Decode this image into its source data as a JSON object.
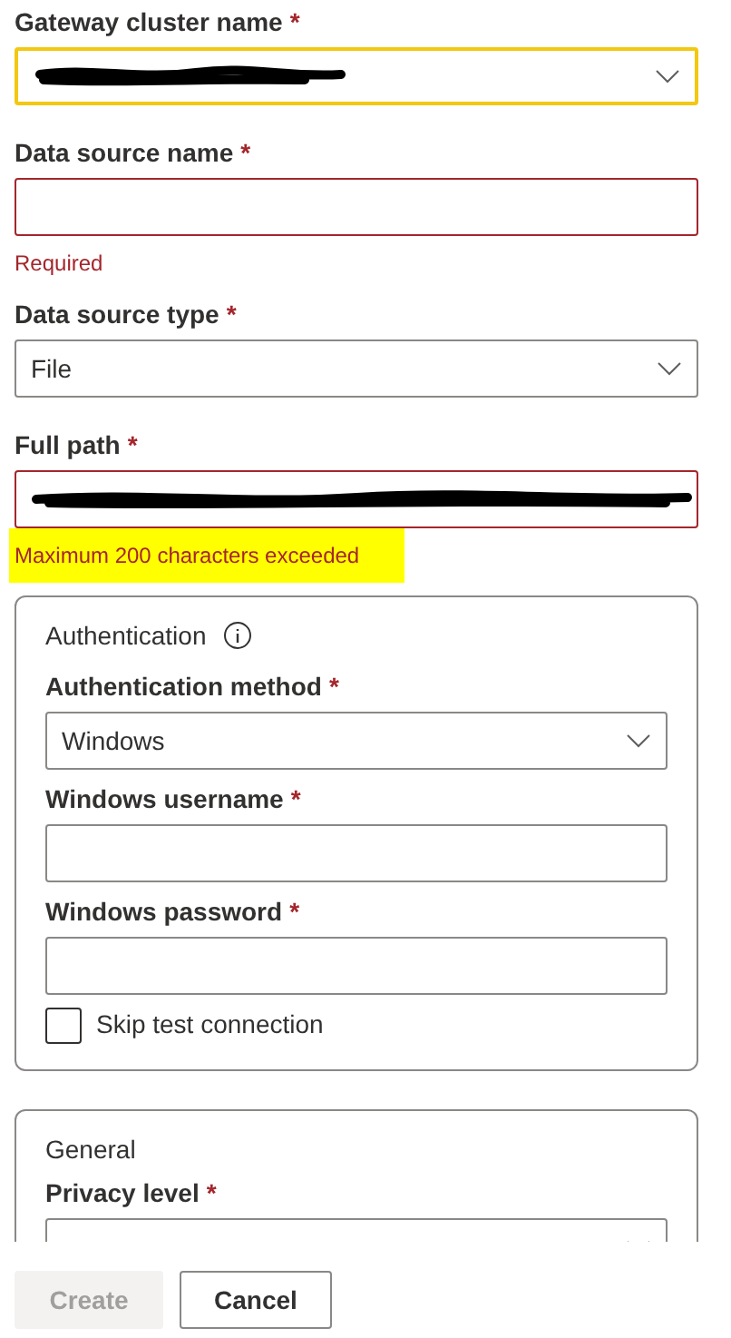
{
  "fields": [
    {
      "kind": "select",
      "label": "Gateway cluster name",
      "required_mark": "*",
      "focused": true,
      "invalid": false,
      "redacted": true
    },
    {
      "kind": "text",
      "label": "Data source name",
      "required_mark": "*",
      "focused": false,
      "invalid": true,
      "redacted": false,
      "error": "Required",
      "error_highlighted": false
    },
    {
      "kind": "select",
      "label": "Data source type",
      "required_mark": "*",
      "focused": false,
      "invalid": false,
      "redacted": false,
      "value": "File"
    },
    {
      "kind": "text",
      "label": "Full path",
      "required_mark": "*",
      "focused": false,
      "invalid": true,
      "redacted": true,
      "error": "Maximum 200 characters exceeded",
      "error_highlighted": true
    }
  ],
  "authentication": {
    "title": "Authentication",
    "fields": [
      {
        "kind": "select",
        "label": "Authentication method",
        "required_mark": "*",
        "value": "Windows"
      },
      {
        "kind": "text",
        "label": "Windows username",
        "required_mark": "*"
      },
      {
        "kind": "text",
        "label": "Windows password",
        "required_mark": "*"
      }
    ],
    "skip_test_connection": {
      "label": "Skip test connection",
      "checked": false
    }
  },
  "general": {
    "title": "General",
    "fields": [
      {
        "label": "Privacy level",
        "required_mark": "*"
      }
    ]
  },
  "buttons": [
    {
      "label": "Create",
      "disabled": true
    },
    {
      "label": "Cancel",
      "disabled": false
    }
  ]
}
